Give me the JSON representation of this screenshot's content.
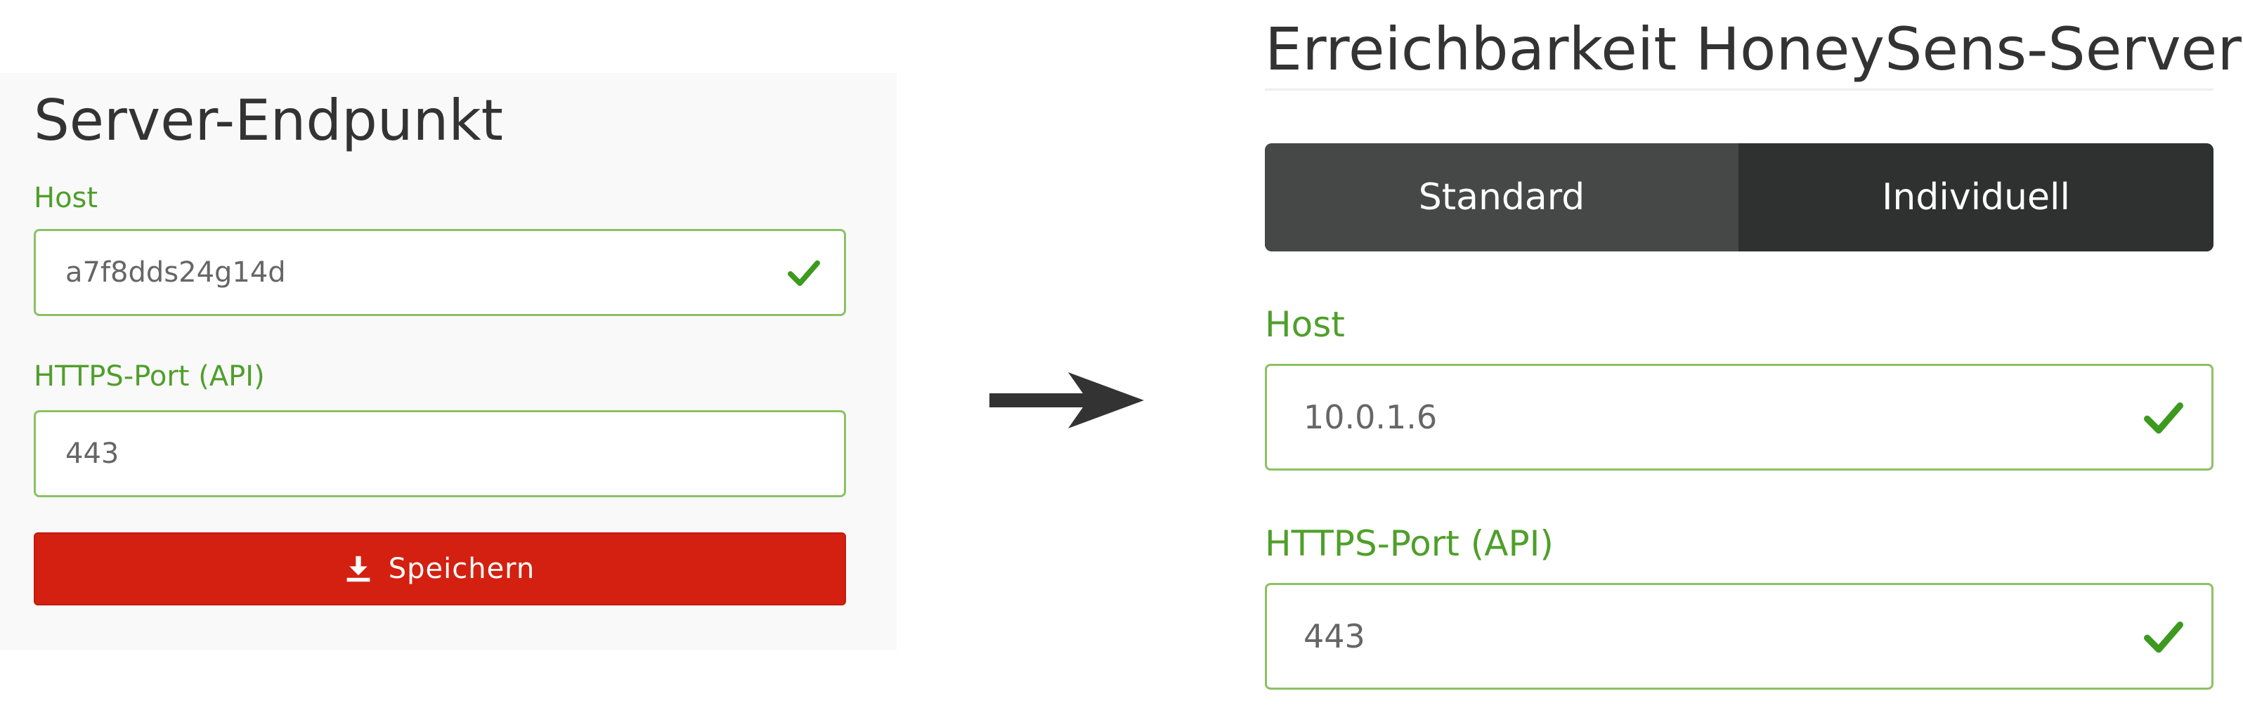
{
  "left_panel": {
    "title": "Server-Endpunkt",
    "host_label": "Host",
    "host_value": "a7f8dds24g14d",
    "port_label": "HTTPS-Port (API)",
    "port_value": "443",
    "save_button_label": "Speichern",
    "save_icon": "download-icon",
    "valid_icon": "checkmark-icon"
  },
  "arrow_icon": "arrow-right-icon",
  "right_panel": {
    "title": "Erreichbarkeit HoneySens-Server",
    "tabs": [
      {
        "label": "Standard"
      },
      {
        "label": "Individuell"
      }
    ],
    "host_label": "Host",
    "host_value": "10.0.1.6",
    "port_label": "HTTPS-Port (API)",
    "port_value": "443",
    "valid_icon": "checkmark-icon"
  },
  "colors": {
    "label_green": "#4f9f2b",
    "field_border_green": "#8bc163",
    "check_green": "#3c9a1f",
    "save_red": "#d42010",
    "segment_active": "#464848",
    "segment_dark": "#2f3131",
    "panel_bg": "#f9f9f9"
  }
}
